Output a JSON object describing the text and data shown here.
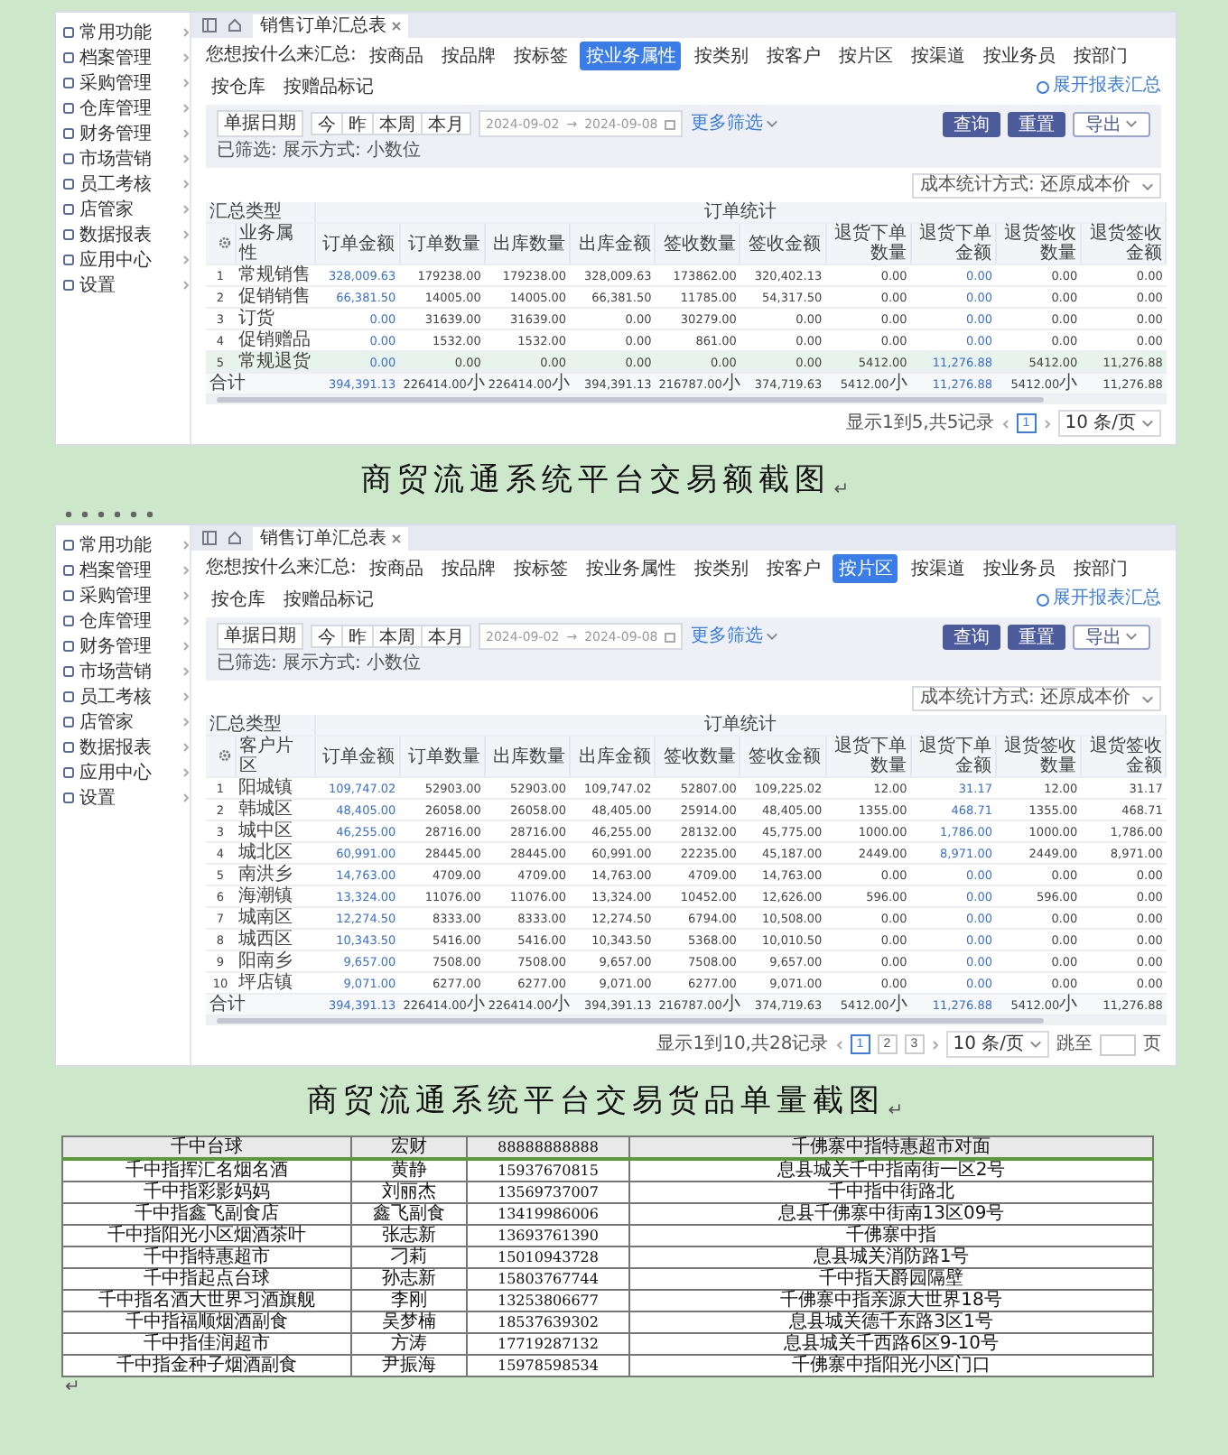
{
  "screenshot_1": {
    "tab_title": "销售订单汇总表",
    "sidebar": [
      "常用功能",
      "档案管理",
      "采购管理",
      "仓库管理",
      "财务管理",
      "市场营销",
      "员工考核",
      "店管家",
      "数据报表",
      "应用中心",
      "设置"
    ],
    "group_by_label": "您想按什么来汇总:",
    "group_by": [
      {
        "label": "按商品",
        "selected": false
      },
      {
        "label": "按品牌",
        "selected": false
      },
      {
        "label": "按标签",
        "selected": false
      },
      {
        "label": "按业务属性",
        "selected": true
      },
      {
        "label": "按类别",
        "selected": false
      },
      {
        "label": "按客户",
        "selected": false
      },
      {
        "label": "按片区",
        "selected": false
      },
      {
        "label": "按渠道",
        "selected": false
      },
      {
        "label": "按业务员",
        "selected": false
      },
      {
        "label": "按部门",
        "selected": false
      },
      {
        "label": "按仓库",
        "selected": false
      },
      {
        "label": "按赠品标记",
        "selected": false
      }
    ],
    "expand_link": "展开报表汇总",
    "date_label": "单据日期",
    "quick_dates": [
      "今",
      "昨",
      "本周",
      "本月"
    ],
    "date_from": "2024-09-02",
    "range_separator": "→",
    "date_to": "2024-09-08",
    "more_filters": "更多筛选",
    "selected_conditions": "已筛选: 展示方式: 小数位",
    "buttons": [
      "查询",
      "重置"
    ],
    "export": "导出",
    "cost_select": "成本统计方式: 还原成本价",
    "table": {
      "group_headers": [
        "汇总类型",
        "订单统计"
      ],
      "columns": [
        {
          "kind": "index"
        },
        {
          "label": "业务属性",
          "kind": "text"
        },
        {
          "label": "订单金额",
          "kind": "link"
        },
        {
          "label": "订单数量",
          "kind": "number"
        },
        {
          "label": "出库数量",
          "kind": "number"
        },
        {
          "label": "出库金额",
          "kind": "number"
        },
        {
          "label": "签收数量",
          "kind": "number"
        },
        {
          "label": "签收金额",
          "kind": "number"
        },
        {
          "label": "退货下单数量",
          "kind": "number"
        },
        {
          "label": "退货下单金额",
          "kind": "link"
        },
        {
          "label": "退货签收数量",
          "kind": "number"
        },
        {
          "label": "退货签收金额",
          "kind": "number"
        }
      ],
      "rows": [
        {
          "selected": false,
          "cells": [
            "1",
            "常规销售",
            "328,009.63",
            "179238.00",
            "179238.00",
            "328,009.63",
            "173862.00",
            "320,402.13",
            "0.00",
            "0.00",
            "0.00",
            "0.00"
          ]
        },
        {
          "selected": false,
          "cells": [
            "2",
            "促销销售",
            "66,381.50",
            "14005.00",
            "14005.00",
            "66,381.50",
            "11785.00",
            "54,317.50",
            "0.00",
            "0.00",
            "0.00",
            "0.00"
          ]
        },
        {
          "selected": false,
          "cells": [
            "3",
            "订货",
            "0.00",
            "31639.00",
            "31639.00",
            "0.00",
            "30279.00",
            "0.00",
            "0.00",
            "0.00",
            "0.00",
            "0.00"
          ]
        },
        {
          "selected": false,
          "cells": [
            "4",
            "促销赠品",
            "0.00",
            "1532.00",
            "1532.00",
            "0.00",
            "861.00",
            "0.00",
            "0.00",
            "0.00",
            "0.00",
            "0.00"
          ]
        },
        {
          "selected": true,
          "cells": [
            "5",
            "常规退货",
            "0.00",
            "0.00",
            "0.00",
            "0.00",
            "0.00",
            "0.00",
            "5412.00",
            "11,276.88",
            "5412.00",
            "11,276.88"
          ]
        }
      ],
      "total": {
        "label": "合计",
        "cells": [
          "394,391.13",
          "226414.00小",
          "226414.00小",
          "394,391.13",
          "216787.00小",
          "374,719.63",
          "5412.00小",
          "11,276.88",
          "5412.00小",
          "11,276.88"
        ]
      }
    },
    "pagination": {
      "summary": "显示1到5,共5记录",
      "pages": [
        {
          "label": "1",
          "selected": true
        }
      ],
      "page_size": "10 条/页"
    }
  },
  "caption_1": {
    "text": "商贸流通系统平台交易额截图",
    "mark": "↵"
  },
  "screenshot_2": {
    "tab_title": "销售订单汇总表",
    "sidebar": [
      "常用功能",
      "档案管理",
      "采购管理",
      "仓库管理",
      "财务管理",
      "市场营销",
      "员工考核",
      "店管家",
      "数据报表",
      "应用中心",
      "设置"
    ],
    "group_by_label": "您想按什么来汇总:",
    "group_by": [
      {
        "label": "按商品",
        "selected": false
      },
      {
        "label": "按品牌",
        "selected": false
      },
      {
        "label": "按标签",
        "selected": false
      },
      {
        "label": "按业务属性",
        "selected": false
      },
      {
        "label": "按类别",
        "selected": false
      },
      {
        "label": "按客户",
        "selected": false
      },
      {
        "label": "按片区",
        "selected": true
      },
      {
        "label": "按渠道",
        "selected": false
      },
      {
        "label": "按业务员",
        "selected": false
      },
      {
        "label": "按部门",
        "selected": false
      },
      {
        "label": "按仓库",
        "selected": false
      },
      {
        "label": "按赠品标记",
        "selected": false
      }
    ],
    "expand_link": "展开报表汇总",
    "date_label": "单据日期",
    "quick_dates": [
      "今",
      "昨",
      "本周",
      "本月"
    ],
    "date_from": "2024-09-02",
    "range_separator": "→",
    "date_to": "2024-09-08",
    "more_filters": "更多筛选",
    "selected_conditions": "已筛选: 展示方式: 小数位",
    "buttons": [
      "查询",
      "重置"
    ],
    "export": "导出",
    "cost_select": "成本统计方式: 还原成本价",
    "table": {
      "group_headers": [
        "汇总类型",
        "订单统计"
      ],
      "columns": [
        {
          "kind": "index"
        },
        {
          "label": "客户片区",
          "kind": "text"
        },
        {
          "label": "订单金额",
          "kind": "link"
        },
        {
          "label": "订单数量",
          "kind": "number"
        },
        {
          "label": "出库数量",
          "kind": "number"
        },
        {
          "label": "出库金额",
          "kind": "number"
        },
        {
          "label": "签收数量",
          "kind": "number"
        },
        {
          "label": "签收金额",
          "kind": "number"
        },
        {
          "label": "退货下单数量",
          "kind": "number"
        },
        {
          "label": "退货下单金额",
          "kind": "link"
        },
        {
          "label": "退货签收数量",
          "kind": "number"
        },
        {
          "label": "退货签收金额",
          "kind": "number"
        }
      ],
      "rows": [
        {
          "selected": false,
          "cells": [
            "1",
            "阳城镇",
            "109,747.02",
            "52903.00",
            "52903.00",
            "109,747.02",
            "52807.00",
            "109,225.02",
            "12.00",
            "31.17",
            "12.00",
            "31.17"
          ]
        },
        {
          "selected": false,
          "cells": [
            "2",
            "韩城区",
            "48,405.00",
            "26058.00",
            "26058.00",
            "48,405.00",
            "25914.00",
            "48,405.00",
            "1355.00",
            "468.71",
            "1355.00",
            "468.71"
          ]
        },
        {
          "selected": false,
          "cells": [
            "3",
            "城中区",
            "46,255.00",
            "28716.00",
            "28716.00",
            "46,255.00",
            "28132.00",
            "45,775.00",
            "1000.00",
            "1,786.00",
            "1000.00",
            "1,786.00"
          ]
        },
        {
          "selected": false,
          "cells": [
            "4",
            "城北区",
            "60,991.00",
            "28445.00",
            "28445.00",
            "60,991.00",
            "22235.00",
            "45,187.00",
            "2449.00",
            "8,971.00",
            "2449.00",
            "8,971.00"
          ]
        },
        {
          "selected": false,
          "cells": [
            "5",
            "南洪乡",
            "14,763.00",
            "4709.00",
            "4709.00",
            "14,763.00",
            "4709.00",
            "14,763.00",
            "0.00",
            "0.00",
            "0.00",
            "0.00"
          ]
        },
        {
          "selected": false,
          "cells": [
            "6",
            "海潮镇",
            "13,324.00",
            "11076.00",
            "11076.00",
            "13,324.00",
            "10452.00",
            "12,626.00",
            "596.00",
            "0.00",
            "596.00",
            "0.00"
          ]
        },
        {
          "selected": false,
          "cells": [
            "7",
            "城南区",
            "12,274.50",
            "8333.00",
            "8333.00",
            "12,274.50",
            "6794.00",
            "10,508.00",
            "0.00",
            "0.00",
            "0.00",
            "0.00"
          ]
        },
        {
          "selected": false,
          "cells": [
            "8",
            "城西区",
            "10,343.50",
            "5416.00",
            "5416.00",
            "10,343.50",
            "5368.00",
            "10,010.50",
            "0.00",
            "0.00",
            "0.00",
            "0.00"
          ]
        },
        {
          "selected": false,
          "cells": [
            "9",
            "阳南乡",
            "9,657.00",
            "7508.00",
            "7508.00",
            "9,657.00",
            "7508.00",
            "9,657.00",
            "0.00",
            "0.00",
            "0.00",
            "0.00"
          ]
        },
        {
          "selected": false,
          "cells": [
            "10",
            "坪店镇",
            "9,071.00",
            "6277.00",
            "6277.00",
            "9,071.00",
            "6277.00",
            "9,071.00",
            "0.00",
            "0.00",
            "0.00",
            "0.00"
          ]
        }
      ],
      "total": {
        "label": "合计",
        "cells": [
          "394,391.13",
          "226414.00小",
          "226414.00小",
          "394,391.13",
          "216787.00小",
          "374,719.63",
          "5412.00小",
          "11,276.88",
          "5412.00小",
          "11,276.88"
        ]
      }
    },
    "pagination": {
      "summary": "显示1到10,共28记录",
      "pages": [
        {
          "label": "1",
          "selected": true
        },
        {
          "label": "2",
          "selected": false
        },
        {
          "label": "3",
          "selected": false
        }
      ],
      "page_size": "10 条/页",
      "jump_label": "跳至",
      "jump_unit": "页"
    }
  },
  "caption_2": {
    "text": "商贸流通系统平台交易货品单量截图",
    "mark": "↵"
  },
  "contact_table": {
    "rows": [
      [
        "千中台球",
        "宏财",
        "88888888888",
        "千佛寨中指特惠超市对面"
      ],
      [
        "千中指挥汇名烟名酒",
        "黄静",
        "15937670815",
        "息县城关千中指南街一区2号"
      ],
      [
        "千中指彩影妈妈",
        "刘丽杰",
        "13569737007",
        "千中指中街路北"
      ],
      [
        "千中指鑫飞副食店",
        "鑫飞副食",
        "13419986006",
        "息县千佛寨中街南13区09号"
      ],
      [
        "千中指阳光小区烟酒茶叶",
        "张志新",
        "13693761390",
        "千佛寨中指"
      ],
      [
        "千中指特惠超市",
        "刁莉",
        "15010943728",
        "息县城关消防路1号"
      ],
      [
        "千中指起点台球",
        "孙志新",
        "15803767744",
        "千中指天爵园隔壁"
      ],
      [
        "千中指名酒大世界习酒旗舰",
        "李刚",
        "13253806677",
        "千佛寨中指亲源大世界18号"
      ],
      [
        "千中指福顺烟酒副食",
        "吴梦楠",
        "18537639302",
        "息县城关德千东路3区1号"
      ],
      [
        "千中指佳润超市",
        "方涛",
        "17719287132",
        "息县城关千西路6区9-10号"
      ],
      [
        "千中指金种子烟酒副食",
        "尹振海",
        "15978598534",
        "千佛寨中指阳光小区门口"
      ]
    ],
    "end_mark": "↵"
  }
}
